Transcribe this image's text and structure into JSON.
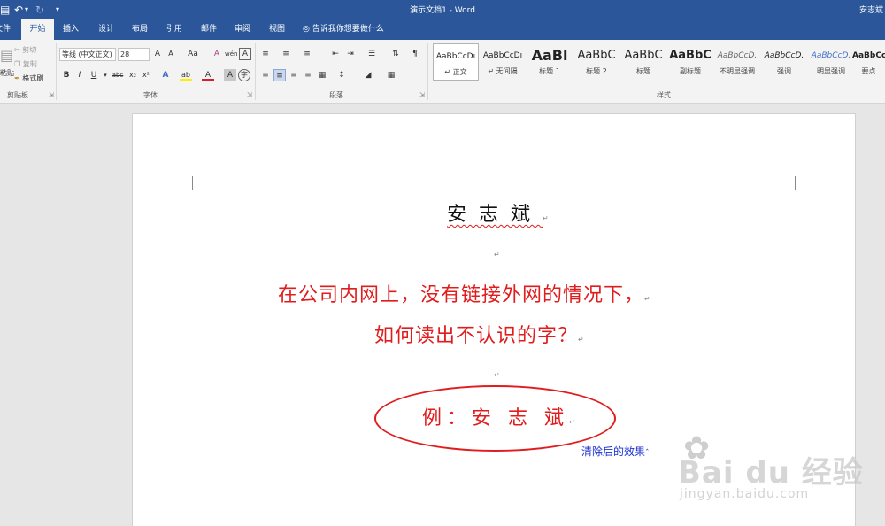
{
  "titlebar": {
    "title": "演示文档1  -  Word",
    "user": "安志斌",
    "save_icon": "save-icon",
    "undo_icon": "undo-icon",
    "redo_icon": "redo-icon",
    "customize_icon": "customize-qat-icon"
  },
  "tabs": [
    {
      "label": "文件"
    },
    {
      "label": "开始"
    },
    {
      "label": "插入"
    },
    {
      "label": "设计"
    },
    {
      "label": "布局"
    },
    {
      "label": "引用"
    },
    {
      "label": "邮件"
    },
    {
      "label": "审阅"
    },
    {
      "label": "视图"
    }
  ],
  "tellme": "告诉我你想要做什么",
  "clipboard": {
    "paste": "粘贴",
    "cut": "剪切",
    "copy": "复制",
    "format_painter": "格式刷",
    "label": "剪贴板"
  },
  "font": {
    "font_name": "等线 (中文正文)",
    "font_size": "28",
    "label": "字体",
    "bold": "B",
    "italic": "I",
    "underline": "U",
    "strike": "abc",
    "subscript": "x₂",
    "superscript": "x²",
    "grow": "A",
    "shrink": "A",
    "case": "Aa",
    "clear": "A",
    "phonetic": "wén",
    "border_char": "A",
    "highlight": "ab",
    "font_color": "A",
    "shading": "A",
    "enclose": "字"
  },
  "paragraph": {
    "label": "段落"
  },
  "styles": {
    "label": "样式",
    "items": [
      {
        "sample": "AaBbCcDı",
        "name": "↵ 正文"
      },
      {
        "sample": "AaBbCcDı",
        "name": "↵ 无间隔"
      },
      {
        "sample": "AaBl",
        "name": "标题 1"
      },
      {
        "sample": "AaBbC",
        "name": "标题 2"
      },
      {
        "sample": "AaBbC",
        "name": "标题"
      },
      {
        "sample": "AaBbC",
        "name": "副标题"
      },
      {
        "sample": "AaBbCcD.",
        "name": "不明显强调"
      },
      {
        "sample": "AaBbCcD.",
        "name": "强调"
      },
      {
        "sample": "AaBbCcD.",
        "name": "明显强调"
      },
      {
        "sample": "AaBbCcI",
        "name": "要点"
      }
    ]
  },
  "document": {
    "name_line": "安志斌",
    "question_line1": "在公司内网上，没有链接外网的情况下，",
    "question_line2": "如何读出不认识的字？",
    "example_line": "例：安 志 斌",
    "caption": "清除后的效果",
    "para_mark": "↵"
  },
  "watermark": {
    "brand": "Bai du 经验",
    "url": "jingyan.baidu.com"
  },
  "colors": {
    "accent": "#2b579a",
    "red_text": "#e01c1c",
    "caption_blue": "#1a2fd0"
  }
}
